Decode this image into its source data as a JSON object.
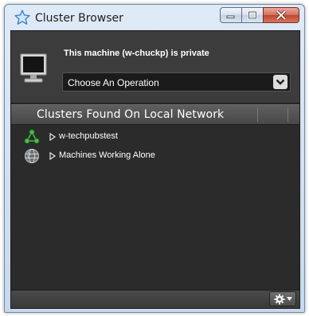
{
  "window": {
    "title": "Cluster Browser",
    "icon": "star-icon"
  },
  "header": {
    "status_text": "This machine (w-chuckp) is private",
    "operation_select": {
      "value": "Choose An Operation"
    }
  },
  "list": {
    "column_title": "Clusters Found On Local Network",
    "items": [
      {
        "label": "w-techpubstest",
        "icon": "cluster-nodes-icon"
      },
      {
        "label": "Machines Working Alone",
        "icon": "globe-icon"
      }
    ]
  },
  "colors": {
    "panel_bg": "#2b2b2b",
    "header_bg": "#3c3c3c",
    "cluster_icon_green": "#3fae3f",
    "close_button_red": "#c0442d"
  }
}
